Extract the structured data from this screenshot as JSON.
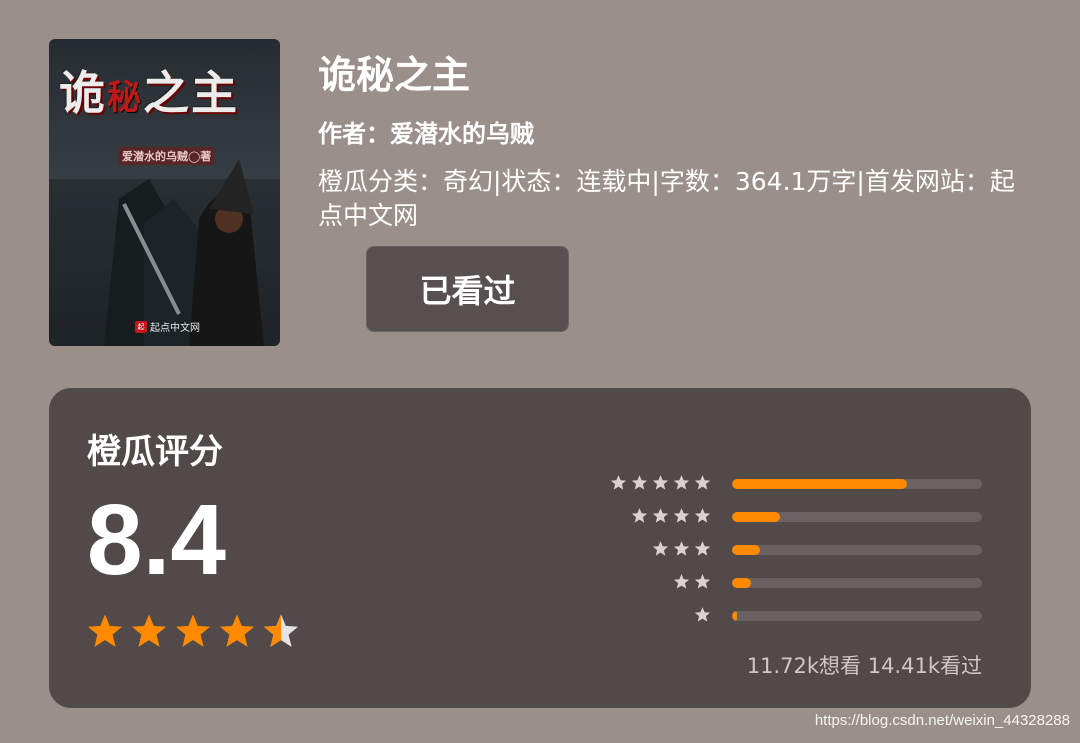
{
  "book": {
    "cover": {
      "title_a": "诡",
      "title_b": "秘",
      "title_c": "之主",
      "author": "爱潜水的乌贼◯著",
      "publisher": "起点中文网",
      "publisher_logo": "起"
    },
    "title": "诡秘之主",
    "author_line": "作者：爱潜水的乌贼",
    "meta_line": "橙瓜分类：奇幻|状态：连载中|字数：364.1万字|首发网站：起点中文网",
    "seen_button": "已看过"
  },
  "rating": {
    "title": "橙瓜评分",
    "score": "8.4",
    "stars_filled": 4.5,
    "distribution": [
      {
        "stars": 5,
        "fraction": 0.7
      },
      {
        "stars": 4,
        "fraction": 0.19
      },
      {
        "stars": 3,
        "fraction": 0.11
      },
      {
        "stars": 2,
        "fraction": 0.075
      },
      {
        "stars": 1,
        "fraction": 0.02
      }
    ],
    "counts": "11.72k想看 14.41k看过"
  },
  "watermark": "https://blog.csdn.net/weixin_44328288",
  "colors": {
    "background": "#9b8f8b",
    "card": "#524a48",
    "accent": "#ff8a00",
    "button": "#585050"
  }
}
